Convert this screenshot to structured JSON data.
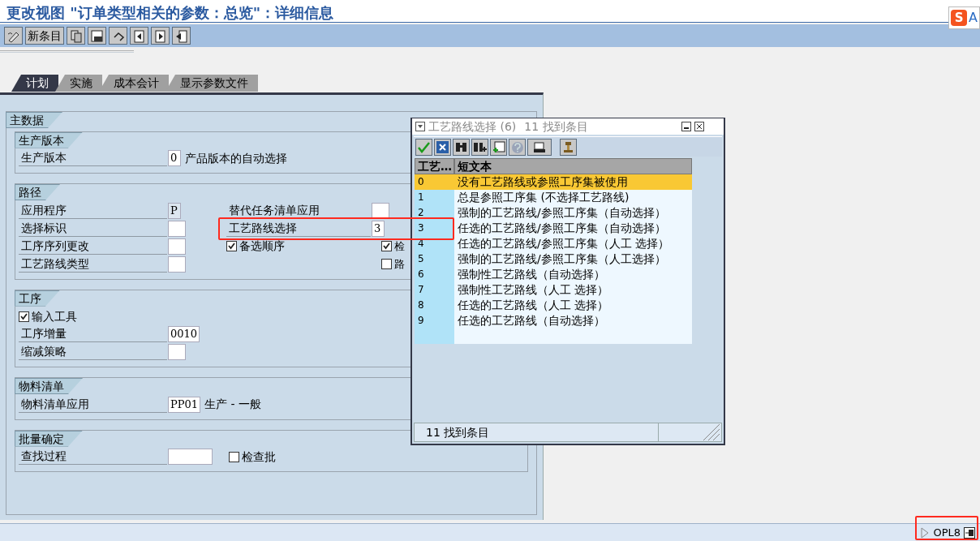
{
  "title": "更改视图 \"订单类型相关的参数：总览\"：详细信息",
  "ime": {
    "logo": "S",
    "mode": "A"
  },
  "toolbar": {
    "new_entry_button": "新条目"
  },
  "tabs": [
    {
      "label": "计划",
      "selected": true
    },
    {
      "label": "实施",
      "selected": false
    },
    {
      "label": "成本会计",
      "selected": false
    },
    {
      "label": "显示参数文件",
      "selected": false
    }
  ],
  "main_group": {
    "title": "主数据",
    "groups": [
      {
        "title": "生产版本",
        "columns": [
          [
            {
              "kind": "field",
              "label": "生产版本",
              "value": "0",
              "description": "产品版本的自动选择"
            }
          ]
        ]
      },
      {
        "title": "路径",
        "columns": [
          [
            {
              "kind": "field",
              "label": "应用程序",
              "value": "P",
              "disabled": true
            },
            {
              "kind": "field",
              "label": "选择标识"
            },
            {
              "kind": "field",
              "label": "工序序列更改"
            },
            {
              "kind": "field",
              "label": "工艺路线类型"
            }
          ],
          [
            {
              "kind": "field",
              "label": "替代任务清单应用"
            },
            {
              "kind": "field",
              "label": "工艺路线选择",
              "value": "3"
            },
            {
              "kind": "checkbox",
              "label": "备选顺序",
              "checked": true
            }
          ],
          [
            {
              "kind": "blank"
            },
            {
              "kind": "blank"
            },
            {
              "kind": "checkbox",
              "label": "检",
              "checked": true
            },
            {
              "kind": "checkbox",
              "label": "路",
              "checked": false
            }
          ]
        ]
      },
      {
        "title": "工序",
        "columns": [
          [
            {
              "kind": "checkbox",
              "label": "输入工具",
              "checked": true
            },
            {
              "kind": "field",
              "label": "工序增量",
              "value": "0010"
            },
            {
              "kind": "field",
              "label": "缩减策略"
            }
          ]
        ]
      },
      {
        "title": "物料清单",
        "columns": [
          [
            {
              "kind": "field",
              "label": "物料清单应用",
              "value": "PP01",
              "description": "生产 - 一般"
            }
          ]
        ]
      },
      {
        "title": "批量确定",
        "columns": [
          [
            {
              "kind": "field",
              "label": "查找过程",
              "wide": true,
              "check": {
                "label": "检查批",
                "checked": false
              }
            }
          ]
        ]
      }
    ]
  },
  "popup": {
    "title": "工艺路线选择 (6)",
    "title_count": "11 找到条目",
    "columns": [
      "工艺…",
      "短文本"
    ],
    "rows": [
      {
        "key": "0",
        "text": "没有工艺路线或参照工序集被使用",
        "selected": true
      },
      {
        "key": "1",
        "text": "总是参照工序集 (不选择工艺路线)",
        "selected": false
      },
      {
        "key": "2",
        "text": "强制的工艺路线/参照工序集（自动选择）",
        "selected": false
      },
      {
        "key": "3",
        "text": "任选的工艺路线/参照工序集（自动选择）",
        "selected": false
      },
      {
        "key": "4",
        "text": "任选的工艺路线/参照工序集（人工 选择）",
        "selected": false
      },
      {
        "key": "5",
        "text": "强制的工艺路线/参照工序集（人工选择）",
        "selected": false
      },
      {
        "key": "6",
        "text": "强制性工艺路线（自动选择）",
        "selected": false
      },
      {
        "key": "7",
        "text": "强制性工艺路线（人工 选择）",
        "selected": false
      },
      {
        "key": "8",
        "text": "任选的工艺路线（人工 选择）",
        "selected": false
      },
      {
        "key": "9",
        "text": "任选的工艺路线（自动选择）",
        "selected": false
      }
    ],
    "status": "11 找到条目"
  },
  "status_bar": {
    "transaction": "OPL8"
  }
}
